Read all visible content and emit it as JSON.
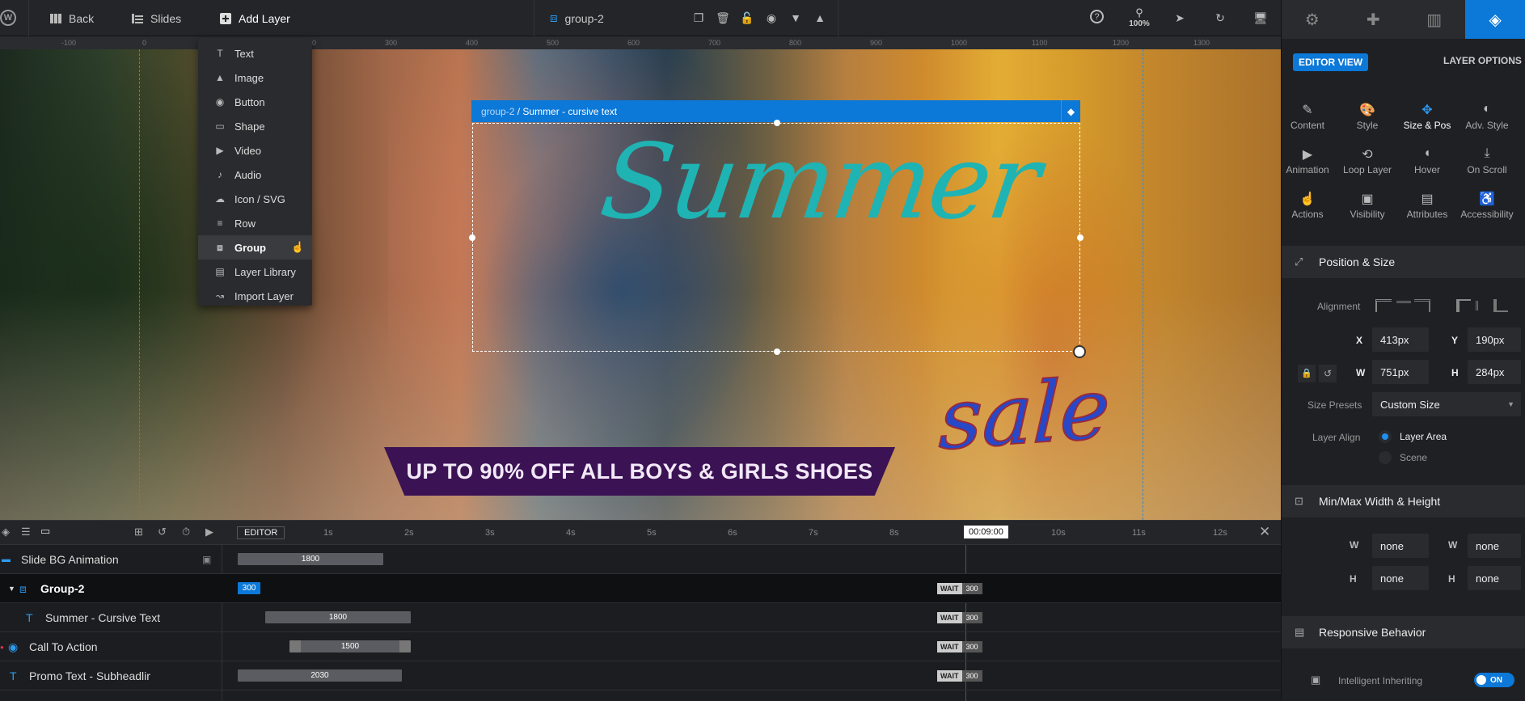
{
  "topbar": {
    "back": "Back",
    "slides": "Slides",
    "add_layer": "Add Layer",
    "layer_name": "group-2",
    "zoom": "100%"
  },
  "ruler": [
    "-100",
    "0",
    "100",
    "200",
    "300",
    "400",
    "500",
    "600",
    "700",
    "800",
    "900",
    "1000",
    "1100",
    "1200",
    "1300"
  ],
  "dropdown": [
    {
      "label": "Text",
      "icon": "T"
    },
    {
      "label": "Image",
      "icon": "▲"
    },
    {
      "label": "Button",
      "icon": "◉"
    },
    {
      "label": "Shape",
      "icon": "▭"
    },
    {
      "label": "Video",
      "icon": "▶"
    },
    {
      "label": "Audio",
      "icon": "♪"
    },
    {
      "label": "Icon / SVG",
      "icon": "☁"
    },
    {
      "label": "Row",
      "icon": "≡"
    },
    {
      "label": "Group",
      "icon": "⧈"
    },
    {
      "label": "Layer Library",
      "icon": "▤"
    },
    {
      "label": "Import Layer",
      "icon": "↝"
    }
  ],
  "canvas": {
    "breadcrumb_parent": "group-2",
    "breadcrumb_sep": " / ",
    "breadcrumb_child": "Summer - cursive text",
    "summer": "Summer",
    "sale": "sale",
    "banner": "UP TO 90% OFF ALL BOYS & GIRLS SHOES"
  },
  "timeline": {
    "editor": "EDITOR",
    "time": "00:09:00",
    "ticks": [
      "1s",
      "2s",
      "3s",
      "4s",
      "5s",
      "6s",
      "7s",
      "8s",
      "9s",
      "10s",
      "11s",
      "12s"
    ],
    "rows": [
      {
        "name": "Slide BG Animation",
        "bar": "1800"
      },
      {
        "name": "Group-2",
        "bar": "300",
        "wait": "WAIT",
        "wait_val": "300"
      },
      {
        "name": "Summer - Cursive Text",
        "bar": "1800",
        "wait": "WAIT",
        "wait_val": "300"
      },
      {
        "name": "Call To Action",
        "bar": "1500",
        "wait": "WAIT",
        "wait_val": "300"
      },
      {
        "name": "Promo Text - Subheadlir",
        "bar": "2030",
        "wait": "WAIT",
        "wait_val": "300"
      }
    ]
  },
  "panel": {
    "editor_view": "EDITOR VIEW",
    "layer_options": "LAYER OPTIONS",
    "tabs": [
      {
        "label": "Content",
        "icon": "✎"
      },
      {
        "label": "Style",
        "icon": "🎨"
      },
      {
        "label": "Size & Pos",
        "icon": "✥"
      },
      {
        "label": "Adv. Style",
        "icon": "◐"
      },
      {
        "label": "Animation",
        "icon": "▶"
      },
      {
        "label": "Loop Layer",
        "icon": "⟲"
      },
      {
        "label": "Hover",
        "icon": "◖"
      },
      {
        "label": "On Scroll",
        "icon": "⤓"
      },
      {
        "label": "Actions",
        "icon": "☝"
      },
      {
        "label": "Visibility",
        "icon": "▣"
      },
      {
        "label": "Attributes",
        "icon": "▤"
      },
      {
        "label": "Accessibility",
        "icon": "♿"
      }
    ],
    "pos_size": "Position & Size",
    "alignment": "Alignment",
    "x_label": "X",
    "x_val": "413px",
    "y_label": "Y",
    "y_val": "190px",
    "w_label": "W",
    "w_val": "751px",
    "h_label": "H",
    "h_val": "284px",
    "size_presets": "Size Presets",
    "preset_val": "Custom Size",
    "layer_align": "Layer Align",
    "layer_area": "Layer Area",
    "scene": "Scene",
    "minmax": "Min/Max Width & Height",
    "min_w": "none",
    "max_w": "none",
    "min_h": "none",
    "max_h": "none",
    "responsive": "Responsive Behavior",
    "intelligent": "Intelligent Inheriting",
    "toggle": "ON"
  }
}
